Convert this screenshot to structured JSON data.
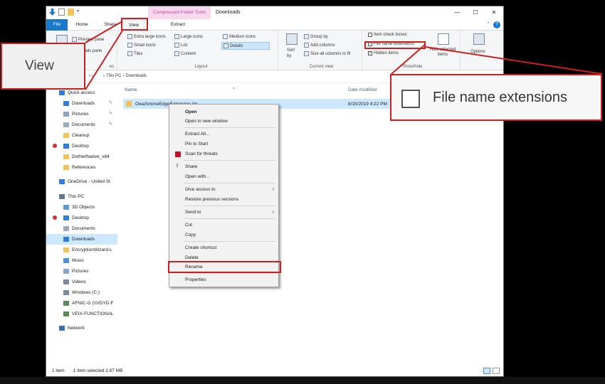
{
  "window": {
    "title": "Downloads",
    "contextual_tab": "Compressed Folder Tools",
    "controls": [
      "—",
      "☐",
      "✕"
    ]
  },
  "tabs": [
    "File",
    "Home",
    "Share",
    "View",
    "Extract"
  ],
  "ribbon": {
    "panes": {
      "preview": "Preview pane",
      "details": "Details pane",
      "label": "es"
    },
    "layout": {
      "items": [
        "Extra large icons",
        "Large icons",
        "Medium icons",
        "Small icons",
        "List",
        "Details",
        "Tiles",
        "Content"
      ],
      "label": "Layout"
    },
    "current_view": {
      "sort_by": "Sort\nby",
      "group_by": "Group by",
      "add_columns": "Add columns",
      "size_columns": "Size all columns to fit",
      "label": "Current view"
    },
    "show_hide": {
      "item_check_boxes": "Item check boxes",
      "file_name_extensions": "File name extensions",
      "hidden_items": "Hidden items",
      "hide_selected": "Hide selected items",
      "options": "Options",
      "label": "Show/hide"
    }
  },
  "address": {
    "path": [
      "This PC",
      "Downloads"
    ]
  },
  "nav": {
    "items": [
      "Quick access",
      "Downloads",
      "Pictures",
      "Documents",
      "Cleanup",
      "Desktop",
      "DotNetNative_x64",
      "References",
      "OneDrive - United St",
      "This PC",
      "3D Objects",
      "Desktop",
      "Documents",
      "Downloads",
      "EncryptionWizard-L",
      "Music",
      "Pictures",
      "Videos",
      "Windows (C:)",
      "AFNIC-G (\\\\VDYD-F",
      "VEIX-FUNCTIONAL",
      "Network"
    ]
  },
  "columns": {
    "name": "Name",
    "date": "Date modified"
  },
  "file": {
    "name": "OwaSmimeEdgeExtension.zip",
    "date": "8/15/2019 4:22 PM"
  },
  "status": {
    "count": "1 item",
    "selected": "1 item selected  2.67 MB"
  },
  "context_menu": {
    "items": [
      "Open",
      "Open in new window",
      "Extract All...",
      "Pin to Start",
      "Scan for threats",
      "Share",
      "Open with...",
      "Give access to",
      "Restore previous versions",
      "Send to",
      "Cut",
      "Copy",
      "Create shortcut",
      "Delete",
      "Rename",
      "Properties"
    ]
  },
  "callouts": {
    "view": "View",
    "extensions": "File name extensions"
  },
  "colors": {
    "accent": "#1979ca",
    "highlight": "#cc1f1f",
    "contextual_tab": "#c5459b",
    "selection": "#cce8ff"
  }
}
